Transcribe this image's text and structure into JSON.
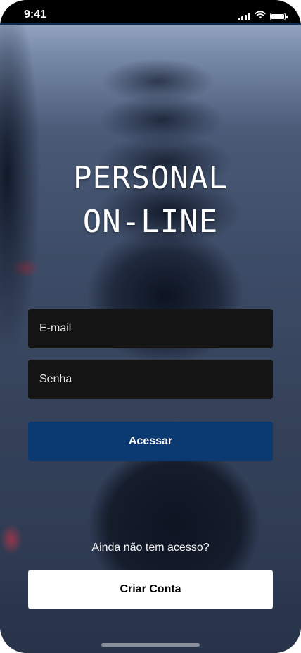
{
  "status_bar": {
    "time": "9:41"
  },
  "app": {
    "title_line1": "PERSONAL",
    "title_line2": "ON-LINE"
  },
  "login": {
    "email_placeholder": "E-mail",
    "password_placeholder": "Senha",
    "submit_label": "Acessar"
  },
  "signup": {
    "prompt": "Ainda não tem acesso?",
    "button_label": "Criar Conta"
  },
  "colors": {
    "primary": "#0b3a73",
    "field_bg": "#141414",
    "secondary_bg": "#ffffff"
  },
  "icons": {
    "signal": "cellular-signal-icon",
    "wifi": "wifi-icon",
    "battery": "battery-icon"
  }
}
